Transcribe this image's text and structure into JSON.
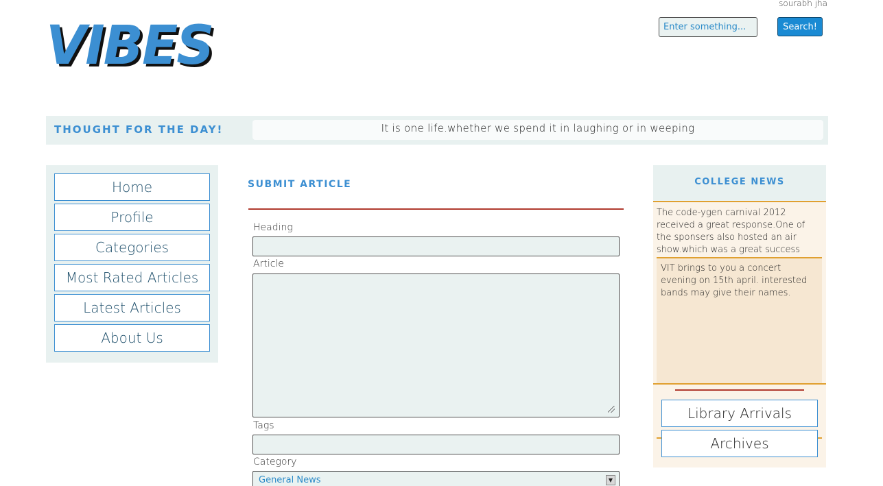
{
  "header": {
    "user_name": "sourabh jha",
    "logo_text": "VIBES",
    "search": {
      "placeholder": "Enter something...",
      "button_label": "Search!"
    }
  },
  "thought": {
    "title": "Thought for the day!",
    "text": "It is one life.whether we spend it in laughing or in weeping"
  },
  "sidebar": {
    "items": [
      {
        "label": "Home"
      },
      {
        "label": "Profile"
      },
      {
        "label": "Categories"
      },
      {
        "label": "Most Rated Articles"
      },
      {
        "label": "Latest Articles"
      },
      {
        "label": "About Us"
      }
    ]
  },
  "main": {
    "title": "Submit Article",
    "form": {
      "heading_label": "Heading",
      "article_label": "Article",
      "tags_label": "Tags",
      "category_label": "Category",
      "category_value": "General News"
    }
  },
  "college_news": {
    "title": "College News",
    "items": [
      {
        "text": "The code-ygen carnival 2012 received a great response.One of the sponsers also hosted an air show.which was a great success"
      },
      {
        "text": "VIT brings to you a concert evening on 15th april. interested bands may give their names."
      }
    ],
    "buttons": [
      {
        "label": "Library Arrivals"
      },
      {
        "label": "Archives"
      }
    ]
  },
  "colors": {
    "accent": "#3c8fd2",
    "panel_bg": "#e8f1f0",
    "news_bg": "#fbf3e8",
    "rule_red": "#b03a2e",
    "rule_orange": "#e0a030"
  }
}
